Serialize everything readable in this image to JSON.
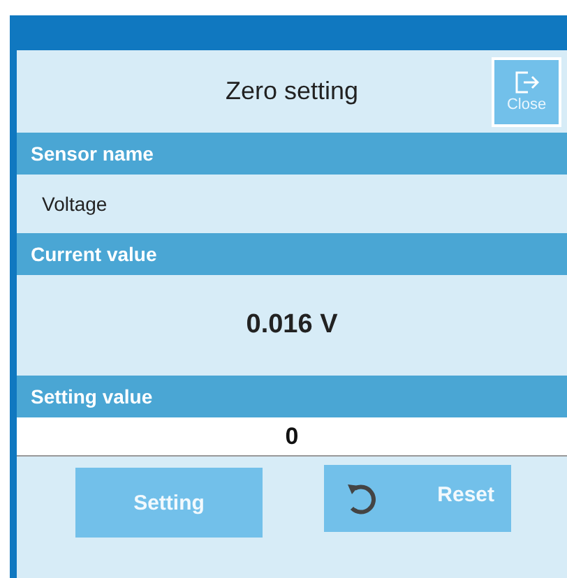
{
  "title": "Zero setting",
  "close_button": {
    "label": "Close"
  },
  "sensor_name": {
    "header": "Sensor name",
    "value": "Voltage"
  },
  "current_value": {
    "header": "Current value",
    "value": "0.016 V"
  },
  "setting_value": {
    "header": "Setting value",
    "value": "0"
  },
  "buttons": [
    {
      "kind": "plain",
      "label": "Setting"
    },
    {
      "kind": "reset",
      "label": "Reset"
    }
  ]
}
